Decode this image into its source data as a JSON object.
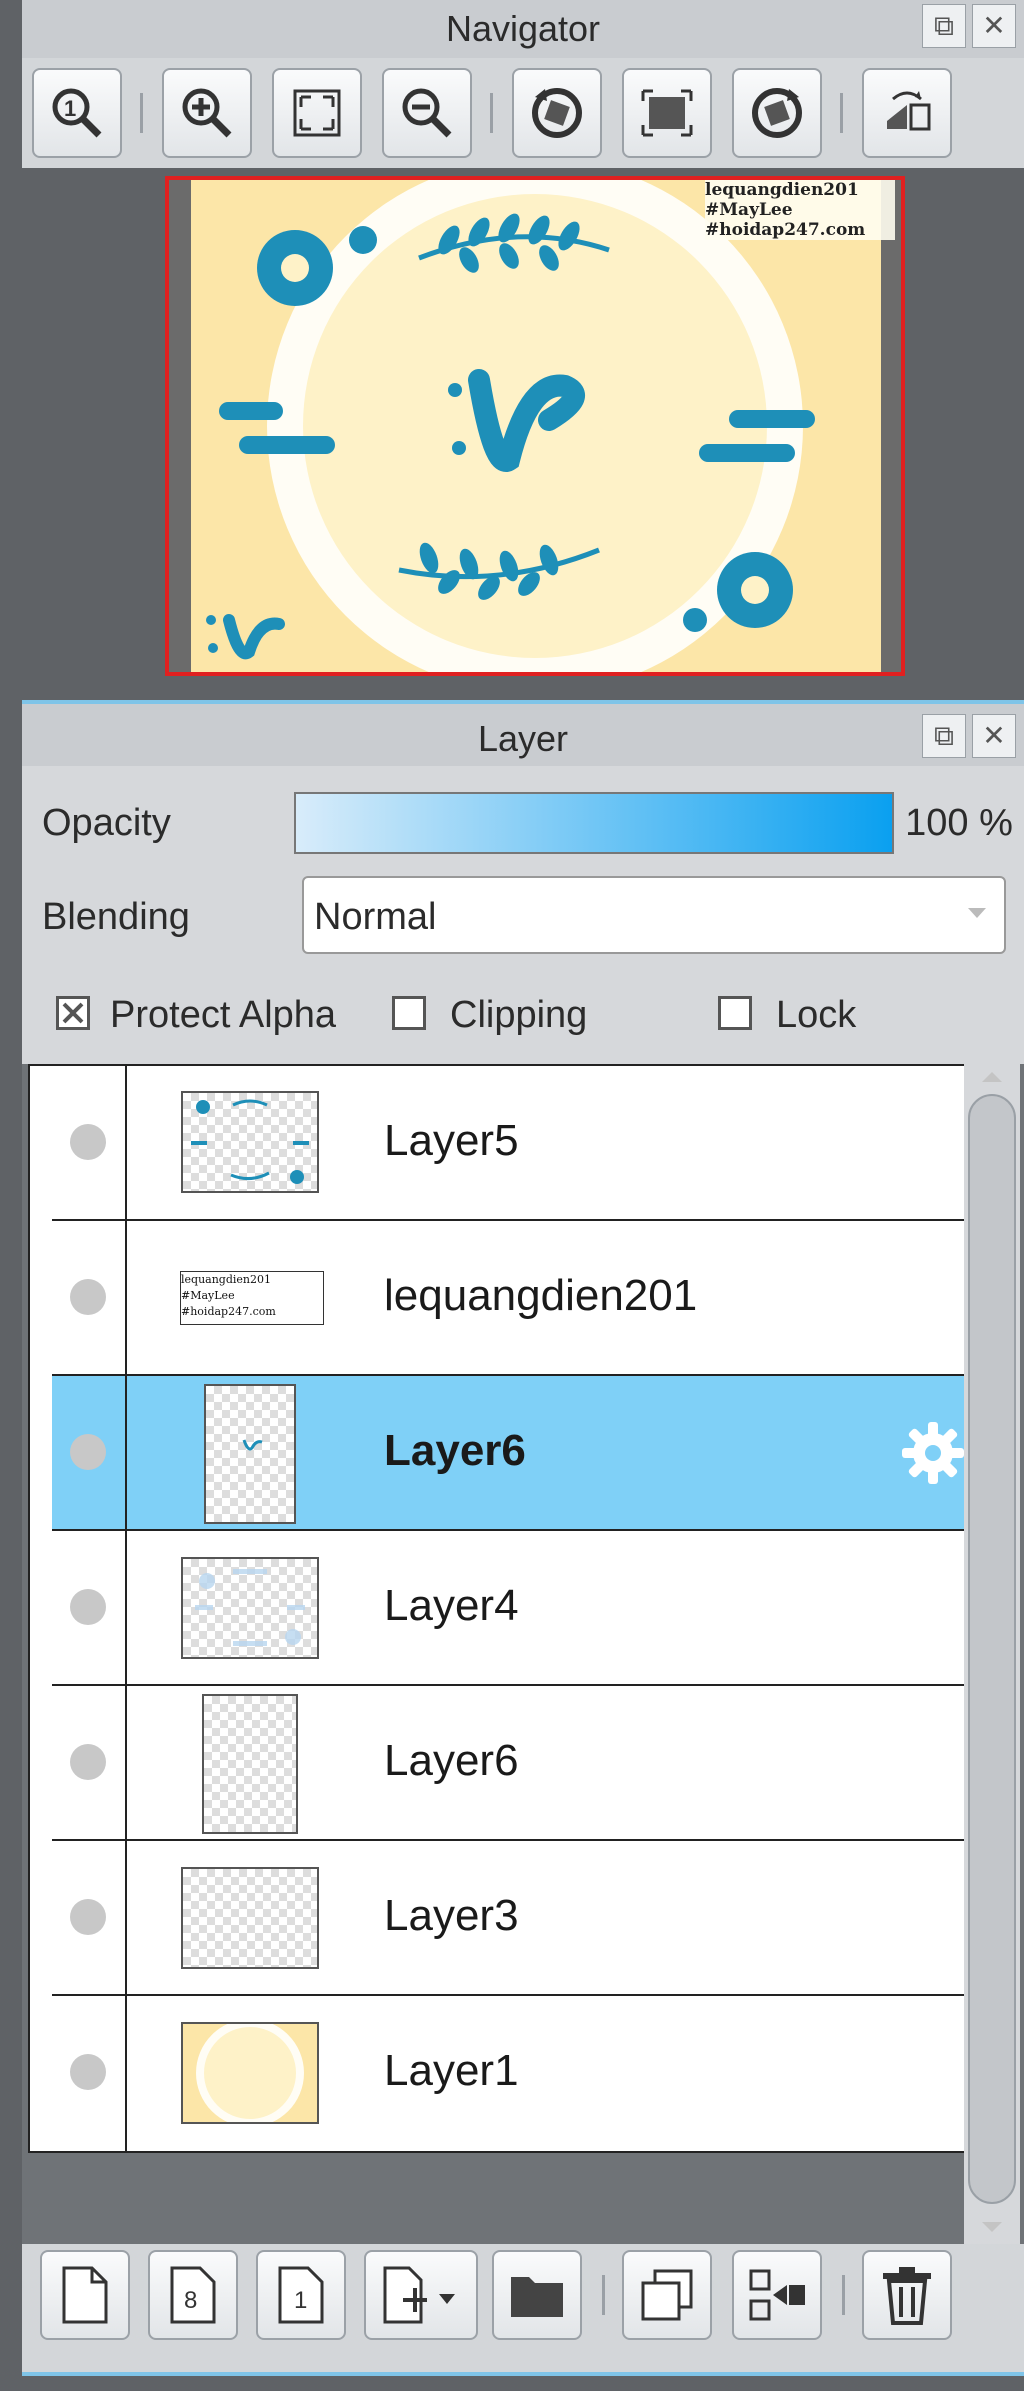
{
  "navigator": {
    "title": "Navigator",
    "tools": [
      "zoom-actual-icon",
      "zoom-in-icon",
      "fit-screen-icon",
      "zoom-out-icon",
      "rotate-left-icon",
      "reset-view-icon",
      "rotate-right-icon",
      "flip-horizontal-icon"
    ],
    "preview_text": [
      "lequangdien201",
      "#MayLee",
      "#hoidap247.com"
    ]
  },
  "layer_panel": {
    "title": "Layer",
    "opacity_label": "Opacity",
    "opacity_value": "100 %",
    "opacity_fraction": 1.0,
    "blending_label": "Blending",
    "blending_value": "Normal",
    "protect_alpha_label": "Protect Alpha",
    "protect_alpha_checked": true,
    "clipping_label": "Clipping",
    "clipping_checked": false,
    "lock_label": "Lock",
    "lock_checked": false,
    "layers": [
      {
        "name": "Layer5",
        "selected": false
      },
      {
        "name": "lequangdien201",
        "selected": false,
        "thumb_text": [
          "lequangdien201",
          "#MayLee",
          "#hoidap247.com"
        ]
      },
      {
        "name": "Layer6",
        "selected": true
      },
      {
        "name": "Layer4",
        "selected": false
      },
      {
        "name": "Layer6",
        "selected": false
      },
      {
        "name": "Layer3",
        "selected": false
      },
      {
        "name": "Layer1",
        "selected": false
      }
    ],
    "bottom_tools": [
      "new-layer-icon",
      "new-8bit-layer-icon",
      "new-1bit-layer-icon",
      "add-layer-menu-icon",
      "new-folder-icon",
      "duplicate-layer-icon",
      "merge-down-icon",
      "delete-layer-icon"
    ]
  },
  "colors": {
    "accent": "#7fd0f7",
    "preview_border": "#e02020",
    "teal": "#1e8fb8"
  }
}
